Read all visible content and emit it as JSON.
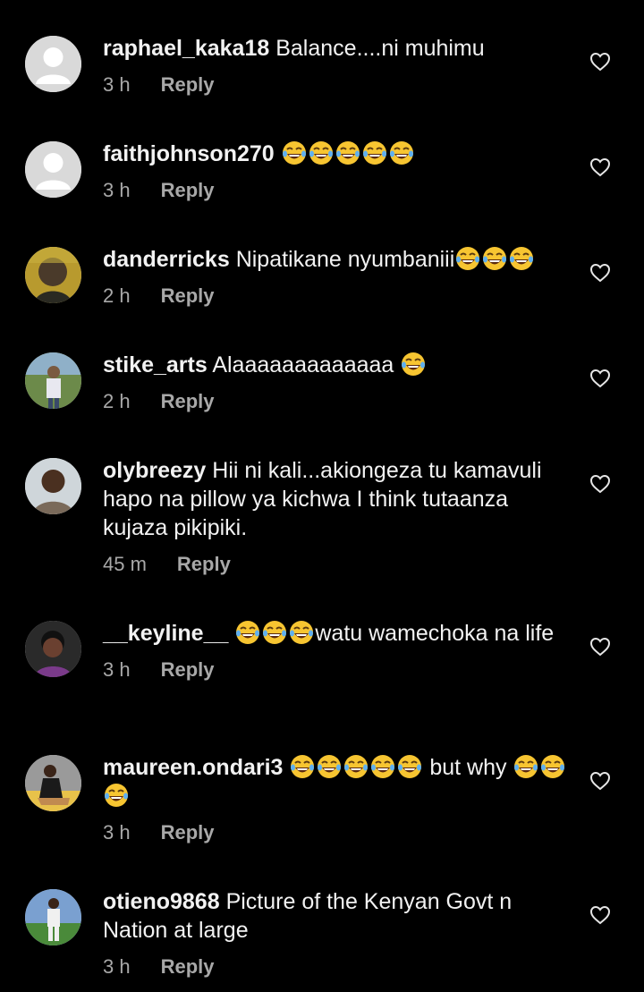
{
  "comments": [
    {
      "username": "raphael_kaka18",
      "text": "Balance....ni muhimu",
      "emoji_count": 0,
      "time": "3 h",
      "reply_label": "Reply",
      "avatar": "default-avatar"
    },
    {
      "username": "faithjohnson270",
      "text": "",
      "emoji_count": 5,
      "time": "3 h",
      "reply_label": "Reply",
      "avatar": "default-avatar"
    },
    {
      "username": "danderricks",
      "text": "Nipatikane nyumbaniii",
      "emoji_count": 3,
      "time": "2 h",
      "reply_label": "Reply",
      "avatar": "photo-avatar"
    },
    {
      "username": "stike_arts",
      "text": "Alaaaaaaaaaaaaa",
      "emoji_count": 1,
      "time": "2 h",
      "reply_label": "Reply",
      "avatar": "photo-avatar"
    },
    {
      "username": "olybreezy",
      "text": "Hii ni kali...akiongeza tu kamavuli hapo na pillow ya kichwa I think tutaanza kujaza pikipiki.",
      "emoji_count": 0,
      "time": "45 m",
      "reply_label": "Reply",
      "avatar": "photo-avatar"
    },
    {
      "username": "__keyline__",
      "text": "watu wamechoka na life",
      "emoji_count": 3,
      "time": "3 h",
      "reply_label": "Reply",
      "avatar": "photo-avatar"
    },
    {
      "username": "maureen.ondari3",
      "text": "but why",
      "emoji_count": 8,
      "time": "3 h",
      "reply_label": "Reply",
      "avatar": "photo-avatar"
    },
    {
      "username": "otieno9868",
      "text": "Picture of the Kenyan Govt n Nation at large",
      "emoji_count": 0,
      "time": "3 h",
      "reply_label": "Reply",
      "avatar": "photo-avatar"
    }
  ],
  "colors": {
    "background": "#000000",
    "text": "#f2f2f2",
    "secondary": "#a8a8a8",
    "emoji": "#f7c531"
  }
}
